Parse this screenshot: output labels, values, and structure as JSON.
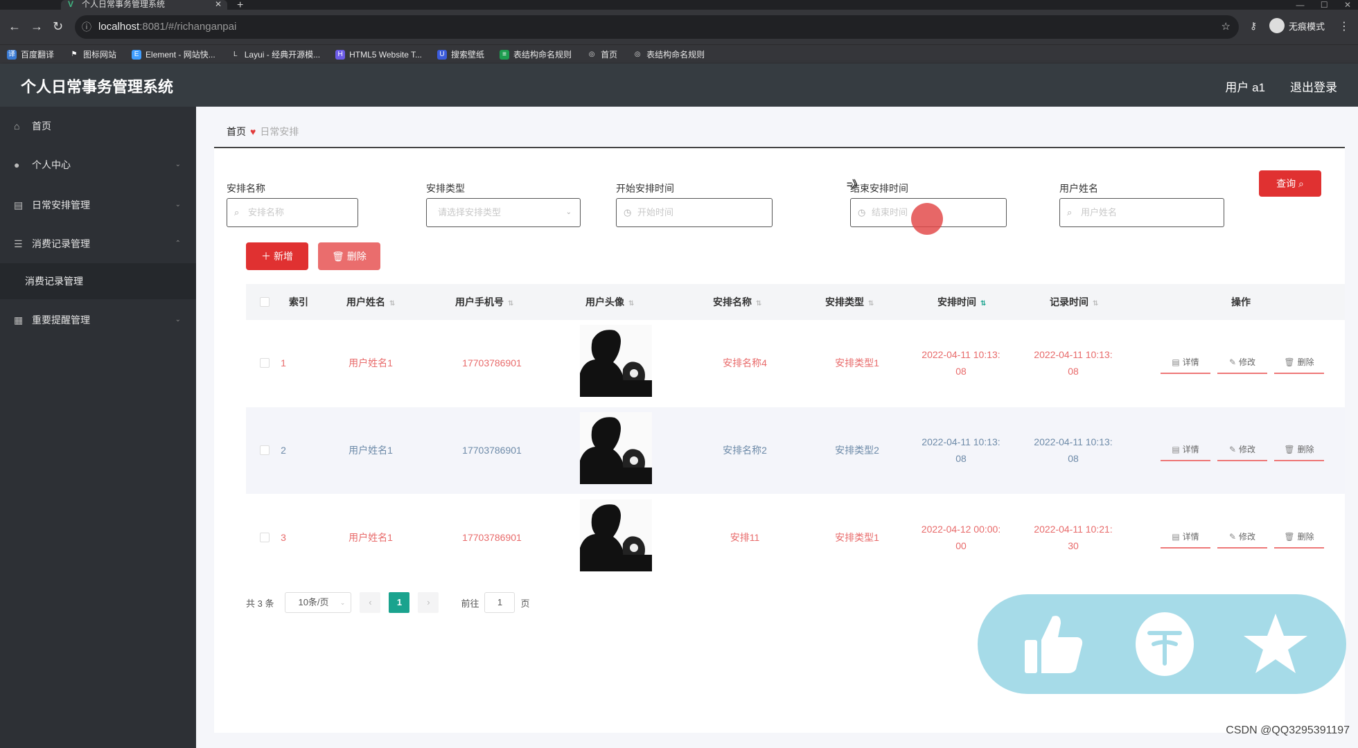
{
  "browser": {
    "tab_title": "个人日常事务管理系统",
    "url_host": "localhost",
    "url_rest": ":8081/#/richanganpai",
    "profile_label": "无痕模式",
    "bookmarks": [
      "百度翻译",
      "图标网站",
      "Element - 网站快...",
      "Layui - 经典开源模...",
      "HTML5 Website T...",
      "搜索壁纸",
      "表结构命名规则",
      "首页",
      "表结构命名规则"
    ]
  },
  "header": {
    "app_title": "个人日常事务管理系统",
    "user_label": "用户 a1",
    "logout_label": "退出登录"
  },
  "sidebar": {
    "items": [
      {
        "label": "首页",
        "icon": "home-icon"
      },
      {
        "label": "个人中心",
        "icon": "user-icon"
      },
      {
        "label": "日常安排管理",
        "icon": "calendar-icon"
      },
      {
        "label": "消费记录管理",
        "icon": "menu-icon"
      },
      {
        "label": "重要提醒管理",
        "icon": "bell-icon"
      }
    ],
    "sub_item": "消费记录管理"
  },
  "breadcrumb": {
    "home": "首页",
    "current": "日常安排"
  },
  "filters": {
    "name_label": "安排名称",
    "name_placeholder": "安排名称",
    "type_label": "安排类型",
    "type_placeholder": "请选择安排类型",
    "start_label": "开始安排时间",
    "start_placeholder": "开始时间",
    "separator": "=》",
    "end_label": "结束安排时间",
    "end_placeholder": "结束时间",
    "user_label": "用户姓名",
    "user_placeholder": "用户姓名",
    "query_button": "查询"
  },
  "actions": {
    "add": "新增",
    "delete": "删除"
  },
  "table": {
    "columns": [
      "索引",
      "用户姓名",
      "用户手机号",
      "用户头像",
      "安排名称",
      "安排类型",
      "安排时间",
      "记录时间",
      "操作"
    ],
    "rows": [
      {
        "index": "1",
        "user": "用户姓名1",
        "phone": "17703786901",
        "name": "安排名称4",
        "type": "安排类型1",
        "time": "2022-04-11 10:13:08",
        "record": "2022-04-11 10:13:08"
      },
      {
        "index": "2",
        "user": "用户姓名1",
        "phone": "17703786901",
        "name": "安排名称2",
        "type": "安排类型2",
        "time": "2022-04-11 10:13:08",
        "record": "2022-04-11 10:13:08"
      },
      {
        "index": "3",
        "user": "用户姓名1",
        "phone": "17703786901",
        "name": "安排11",
        "type": "安排类型1",
        "time": "2022-04-12 00:00:00",
        "record": "2022-04-11 10:21:30"
      }
    ],
    "row_actions": {
      "detail": "详情",
      "edit": "修改",
      "delete": "删除"
    }
  },
  "pagination": {
    "total": "共 3 条",
    "page_size": "10条/页",
    "current_page": "1",
    "goto_label": "前往",
    "goto_value": "1",
    "page_suffix": "页"
  },
  "watermark": "CSDN @QQ3295391197"
}
